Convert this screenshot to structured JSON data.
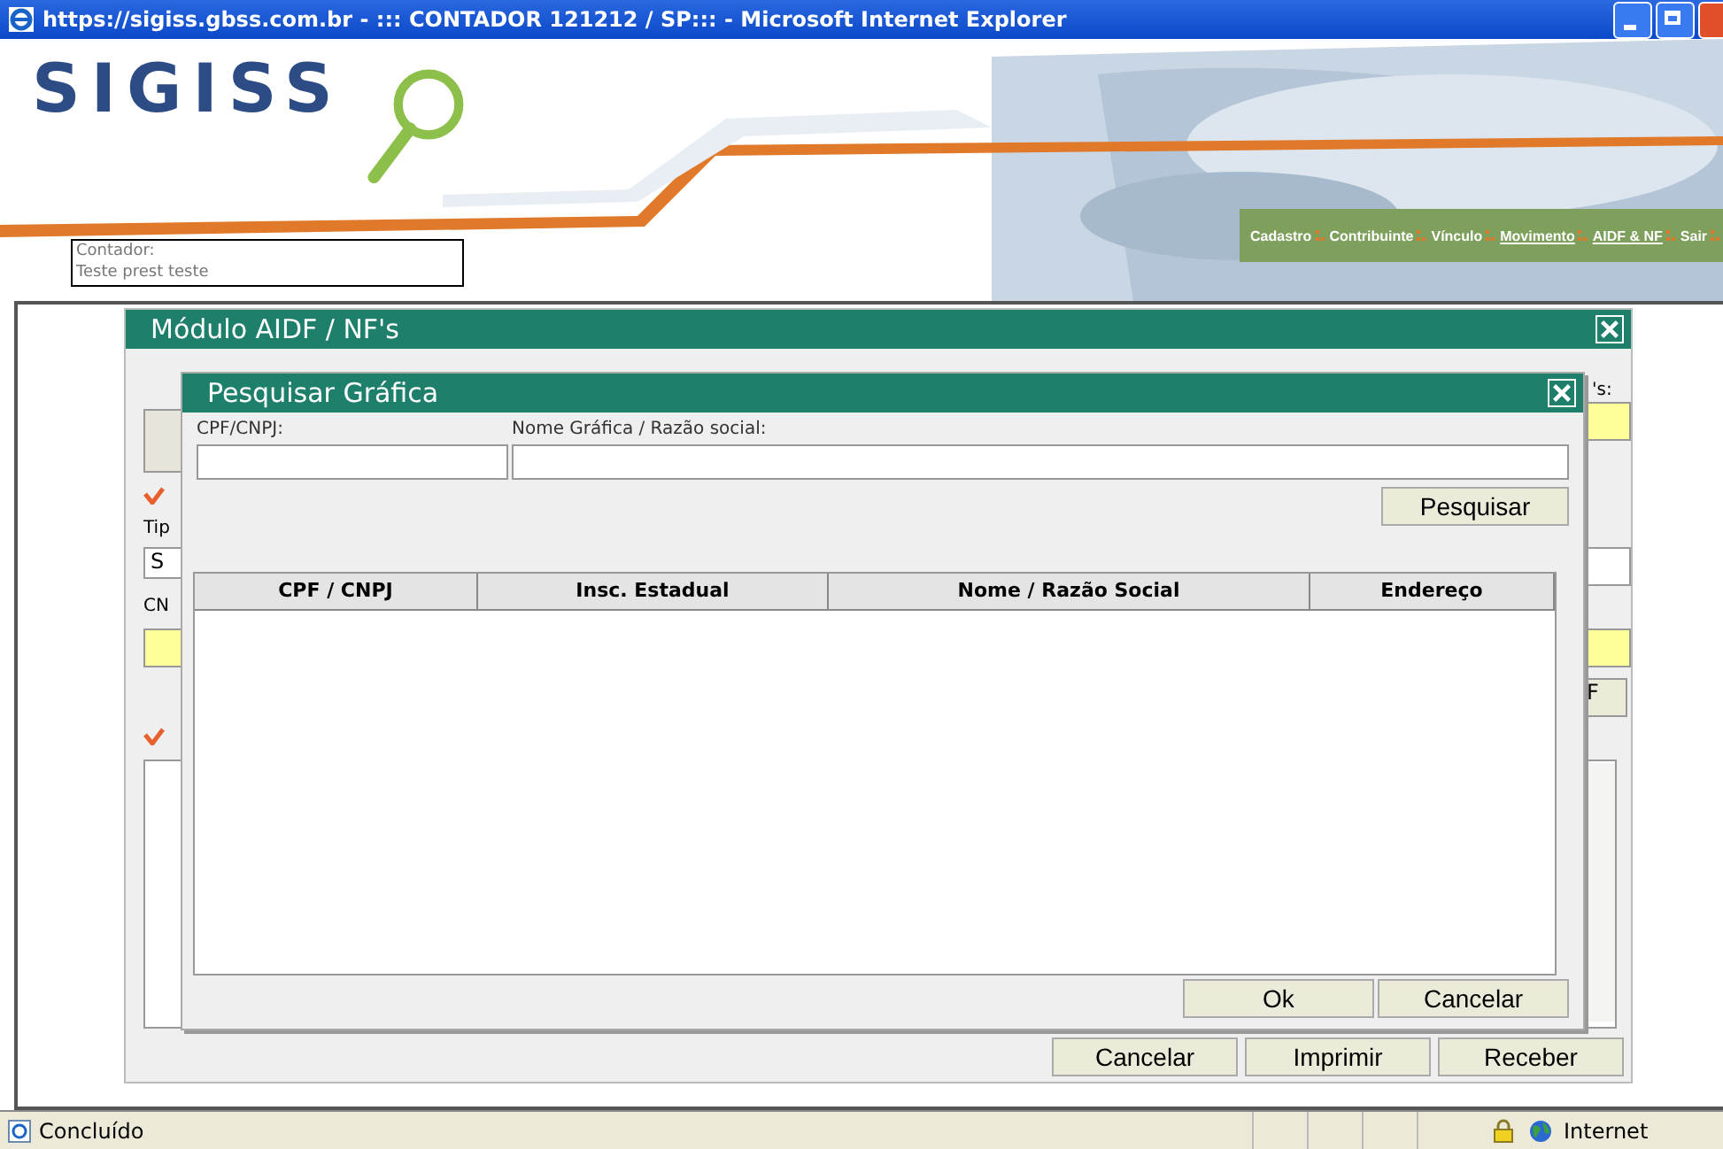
{
  "window": {
    "title": "https://sigiss.gbss.com.br - ::: CONTADOR 121212 / SP::: - Microsoft Internet Explorer"
  },
  "header": {
    "logo": "SIGISS",
    "contador_label": "Contador:",
    "contador_name": "Teste prest teste",
    "nav": [
      {
        "label": "Cadastro",
        "underlined": false
      },
      {
        "label": "Contribuinte",
        "underlined": false
      },
      {
        "label": "Vínculo",
        "underlined": false
      },
      {
        "label": "Movimento",
        "underlined": true
      },
      {
        "label": "AIDF & NF",
        "underlined": true
      },
      {
        "label": "Sair",
        "underlined": false
      }
    ]
  },
  "module_dialog": {
    "title": "Módulo AIDF / NF's",
    "type_label": "Tip",
    "type_value": "S",
    "cn_label": "CN",
    "right_label": "'s:",
    "right_button": "F",
    "buttons": [
      "Cancelar",
      "Imprimir",
      "Receber"
    ]
  },
  "search_dialog": {
    "title": "Pesquisar Gráfica",
    "fields": [
      {
        "label": "CPF/CNPJ:"
      },
      {
        "label": "Nome Gráfica / Razão social:"
      }
    ],
    "search_button": "Pesquisar",
    "columns": [
      "CPF / CNPJ",
      "Insc. Estadual",
      "Nome / Razão Social",
      "Endereço"
    ],
    "buttons": [
      "Ok",
      "Cancelar"
    ]
  },
  "status_bar": {
    "text": "Concluído",
    "zone": "Internet"
  }
}
